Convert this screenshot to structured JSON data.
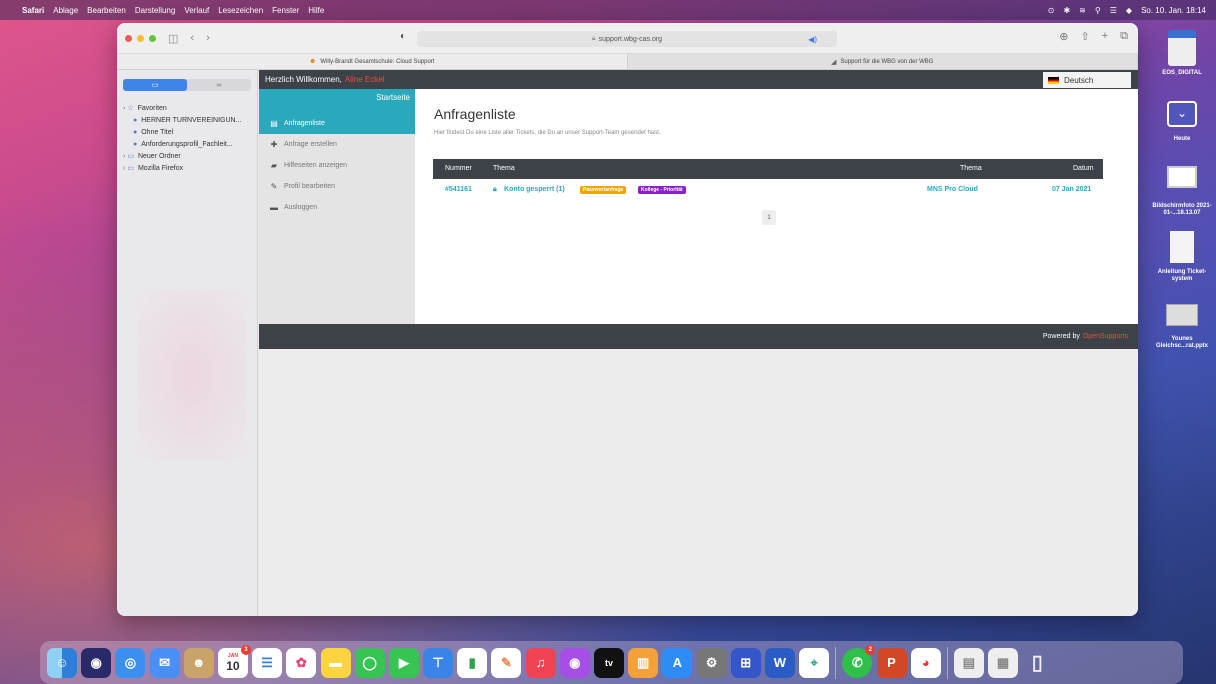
{
  "menubar": {
    "app_name": "Safari",
    "items": [
      "Ablage",
      "Bearbeiten",
      "Darstellung",
      "Verlauf",
      "Lesezeichen",
      "Fenster",
      "Hilfe"
    ],
    "datetime": "So. 10. Jan. 18:14"
  },
  "browser": {
    "address": "support.wbg-cas.org",
    "tabs": [
      {
        "title": "Willy-Brandt Gesamtschule: Cloud Support"
      },
      {
        "title": "Support für die WBG von der WBG"
      }
    ]
  },
  "bookmarks": {
    "favorites_label": "Favoriten",
    "items": [
      {
        "label": "HERNER TURNVEREINIGUN..."
      },
      {
        "label": "Ohne Titel"
      },
      {
        "label": "Anforderungsprofil_Fachleit..."
      }
    ],
    "folders": [
      {
        "label": "Neuer Ordner"
      },
      {
        "label": "Mozilla Firefox"
      }
    ]
  },
  "site": {
    "welcome_label": "Herzlich Willkommen,",
    "user_name": "Aline Eckel",
    "language": "Deutsch",
    "nav_home": "Startseite",
    "nav": [
      {
        "label": "Anfragenliste",
        "icon": "document-icon"
      },
      {
        "label": "Anfrage erstellen",
        "icon": "plus-icon"
      },
      {
        "label": "Hilfeseiten anzeigen",
        "icon": "book-icon"
      },
      {
        "label": "Profil bearbeiten",
        "icon": "pencil-icon"
      },
      {
        "label": "Ausloggen",
        "icon": "lock-icon"
      }
    ],
    "title": "Anfragenliste",
    "description": "Hier findest Du eine Liste aller Tickets, die Du an unser Support-Team gesendet hast.",
    "table": {
      "headers": [
        "Nummer",
        "Thema",
        "Thema",
        "Datum"
      ],
      "row": {
        "number": "#541161",
        "subject": "Konto gesperrt (1)",
        "tags": [
          "Passwortanfrage",
          "Kollege - Priorität"
        ],
        "topic": "MNS Pro Cloud",
        "date": "07 Jan 2021"
      }
    },
    "page": "1",
    "footer_powered": "Powered by",
    "footer_brand": "OpenSupports",
    "colors": {
      "accent": "#2aa9bd",
      "dark": "#3c4248",
      "highlight": "#e0533d",
      "tag1": "#f0a500",
      "tag2": "#8e1fc7"
    }
  },
  "desktop": {
    "icons": [
      {
        "label": "EOS_DIGITAL"
      },
      {
        "label": "Heute"
      },
      {
        "label": "Bildschirmfoto 2021-01-...18.13.07"
      },
      {
        "label": "Anleitung Ticket-system"
      },
      {
        "label": "Younes Gleichsc...rat.pptx"
      }
    ]
  },
  "dock": {
    "calendar_day": "10",
    "calendar_month": "JAN",
    "badges": {
      "calendar": "3",
      "whatsapp": "2"
    }
  }
}
